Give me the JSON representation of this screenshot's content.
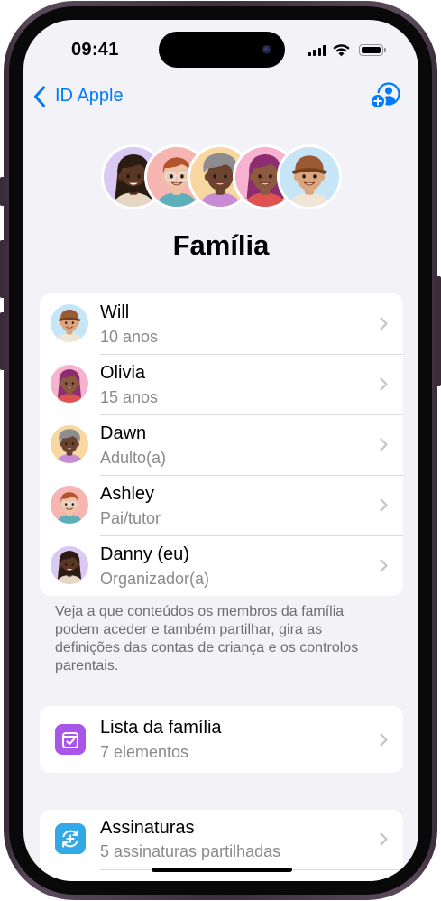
{
  "status_bar": {
    "time": "09:41",
    "battery_level": 100,
    "icons": [
      "cellular-signal-icon",
      "wifi-icon",
      "battery-icon"
    ]
  },
  "nav": {
    "back_label": "ID Apple",
    "back_icon": "chevron-left-icon",
    "action_icon": "add-family-member-icon"
  },
  "header": {
    "title": "Família"
  },
  "members": [
    {
      "name": "Will",
      "detail": "10 anos"
    },
    {
      "name": "Olivia",
      "detail": "15 anos"
    },
    {
      "name": "Dawn",
      "detail": "Adulto(a)"
    },
    {
      "name": "Ashley",
      "detail": "Pai/tutor"
    },
    {
      "name": "Danny (eu)",
      "detail": "Organizador(a)"
    }
  ],
  "members_footer": "Veja a que conteúdos os membros da família podem aceder e também partilhar, gira as definições das contas de criança e os controlos parentais.",
  "family_list": {
    "title": "Lista da família",
    "detail": "7 elementos",
    "icon": "family-checklist-icon"
  },
  "subscriptions": {
    "title": "Assinaturas",
    "detail": "5 assinaturas partilhadas",
    "icon": "subscriptions-icon"
  },
  "theme": {
    "accent": "#007aff",
    "background": "#f2f2f7",
    "family_list_icon": "#a855e8",
    "subscriptions_icon": "#33a8e6"
  }
}
